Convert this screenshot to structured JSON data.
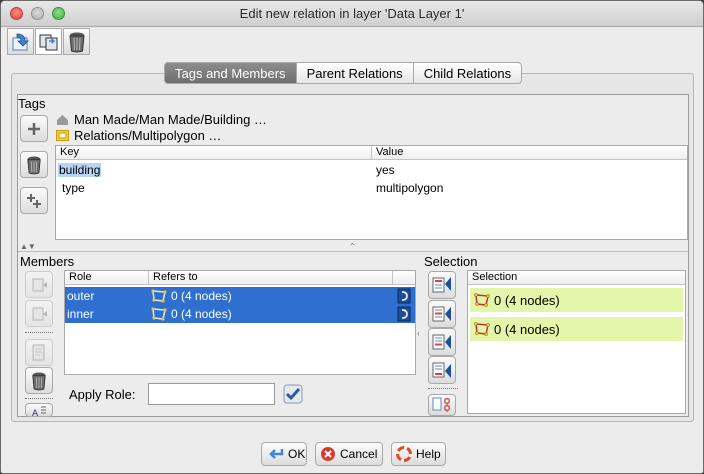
{
  "window": {
    "title": "Edit new relation in layer 'Data Layer 1'"
  },
  "toolbar": {
    "buttons": [
      "apply-to-layer-icon",
      "duplicate-relation-icon",
      "delete-relation-icon"
    ]
  },
  "tabs": [
    {
      "label": "Tags and Members",
      "selected": true
    },
    {
      "label": "Parent Relations",
      "selected": false
    },
    {
      "label": "Child Relations",
      "selected": false
    }
  ],
  "tags": {
    "section_label": "Tags",
    "presets": [
      "Man Made/Man Made/Building …",
      "Relations/Multipolygon …"
    ],
    "headers": {
      "key": "Key",
      "value": "Value"
    },
    "rows": [
      {
        "key": "building",
        "value": "yes"
      },
      {
        "key": "type",
        "value": "multipolygon"
      }
    ]
  },
  "members": {
    "section_label": "Members",
    "headers": {
      "role": "Role",
      "refers": "Refers to"
    },
    "rows": [
      {
        "role": "outer",
        "refers": "0 (4 nodes)"
      },
      {
        "role": "inner",
        "refers": "0 (4 nodes)"
      }
    ],
    "apply_role_label": "Apply Role:",
    "apply_role_value": ""
  },
  "selection": {
    "section_label": "Selection",
    "header": "Selection",
    "rows": [
      "0 (4 nodes)",
      "0 (4 nodes)"
    ]
  },
  "buttons": {
    "ok": "OK",
    "cancel": "Cancel",
    "help": "Help"
  },
  "colors": {
    "selected_row": "#2f6fd0",
    "selection_highlight": "#e2f5a8",
    "tab_selected": "#7a7a7a"
  }
}
